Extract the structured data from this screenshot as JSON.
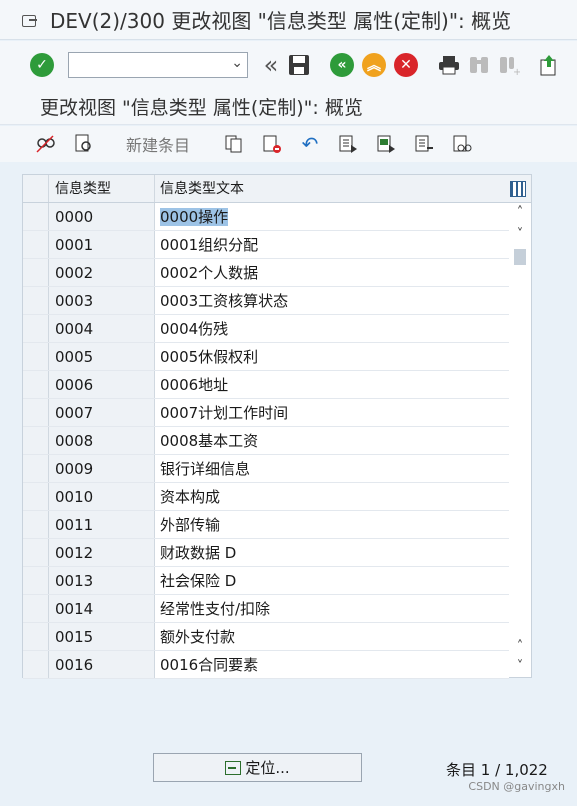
{
  "window": {
    "title": "DEV(2)/300 更改视图 \"信息类型 属性(定制)\": 概览"
  },
  "toolbar": {
    "command_value": "",
    "icons": [
      "check-icon",
      "dropdown-icon",
      "back-double-icon",
      "save-icon",
      "back-icon",
      "exit-icon",
      "cancel-icon",
      "print-icon",
      "find-icon",
      "find-next-icon",
      "new-session-icon"
    ]
  },
  "screen": {
    "title": "更改视图 \"信息类型 属性(定制)\": 概览"
  },
  "app_toolbar": {
    "new_entries_label": "新建条目"
  },
  "table": {
    "columns": [
      "信息类型",
      "信息类型文本"
    ],
    "rows": [
      {
        "code": "0000",
        "text": "0000操作"
      },
      {
        "code": "0001",
        "text": "0001组织分配"
      },
      {
        "code": "0002",
        "text": "0002个人数据"
      },
      {
        "code": "0003",
        "text": "0003工资核算状态"
      },
      {
        "code": "0004",
        "text": "0004伤残"
      },
      {
        "code": "0005",
        "text": "0005休假权利"
      },
      {
        "code": "0006",
        "text": "0006地址"
      },
      {
        "code": "0007",
        "text": "0007计划工作时间"
      },
      {
        "code": "0008",
        "text": "0008基本工资"
      },
      {
        "code": "0009",
        "text": "银行详细信息"
      },
      {
        "code": "0010",
        "text": "资本构成"
      },
      {
        "code": "0011",
        "text": "外部传输"
      },
      {
        "code": "0012",
        "text": "财政数据  D"
      },
      {
        "code": "0013",
        "text": "社会保险  D"
      },
      {
        "code": "0014",
        "text": "经常性支付/扣除"
      },
      {
        "code": "0015",
        "text": "额外支付款"
      },
      {
        "code": "0016",
        "text": "0016合同要素"
      }
    ]
  },
  "footer": {
    "locate_label": "定位...",
    "entries_text": "条目 1 / 1,022",
    "watermark": "CSDN @gavingxh"
  }
}
